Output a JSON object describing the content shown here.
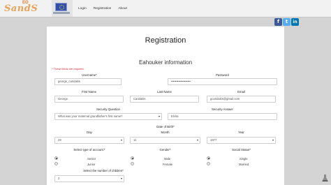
{
  "brand": {
    "logo_text": "SandS",
    "logo_sun": "EO"
  },
  "nav": [
    {
      "label": "Login"
    },
    {
      "label": "Registration"
    },
    {
      "label": "About"
    }
  ],
  "social": {
    "facebook_icon": "f",
    "twitter_icon": "t",
    "linkedin_icon": "in"
  },
  "page": {
    "title": "Registration",
    "section_title": "Eahouker information",
    "required_note": "* These fields are required"
  },
  "form": {
    "username": {
      "label": "Username*",
      "value": "george_caridakis"
    },
    "password": {
      "label": "Password",
      "value": "•••••••••••••••••••"
    },
    "first_name": {
      "label": "First Name",
      "value": "George"
    },
    "last_name": {
      "label": "Last Name",
      "value": "Caridakis"
    },
    "email": {
      "label": "Email",
      "value": "gcaridakis@gmail.com"
    },
    "security_question": {
      "label": "Security Question",
      "value": "What was your maternal grandfather's first name?"
    },
    "security_answer": {
      "label": "Security Answer",
      "value": "Elvira"
    },
    "dob": {
      "label": "Date of Birth*",
      "day_label": "Day",
      "day_value": "29",
      "month_label": "Month",
      "month_value": "11",
      "year_label": "Year",
      "year_value": "1977"
    },
    "account_type": {
      "label": "Select type of account:*",
      "options": [
        {
          "label": "Senior",
          "selected": true
        },
        {
          "label": "Junior",
          "selected": false
        }
      ]
    },
    "gender": {
      "label": "Gender*",
      "options": [
        {
          "label": "Male",
          "selected": true
        },
        {
          "label": "Female",
          "selected": false
        }
      ]
    },
    "social_status": {
      "label": "Social Status*",
      "options": [
        {
          "label": "Single",
          "selected": true
        },
        {
          "label": "Married",
          "selected": false
        }
      ]
    },
    "children": {
      "label": "Select the number of children*",
      "value": "2"
    }
  },
  "colors": {
    "required": "#d9242f",
    "facebook": "#3b5998",
    "twitter": "#55acee",
    "linkedin": "#0077b5",
    "logo": "#e6a45a"
  }
}
